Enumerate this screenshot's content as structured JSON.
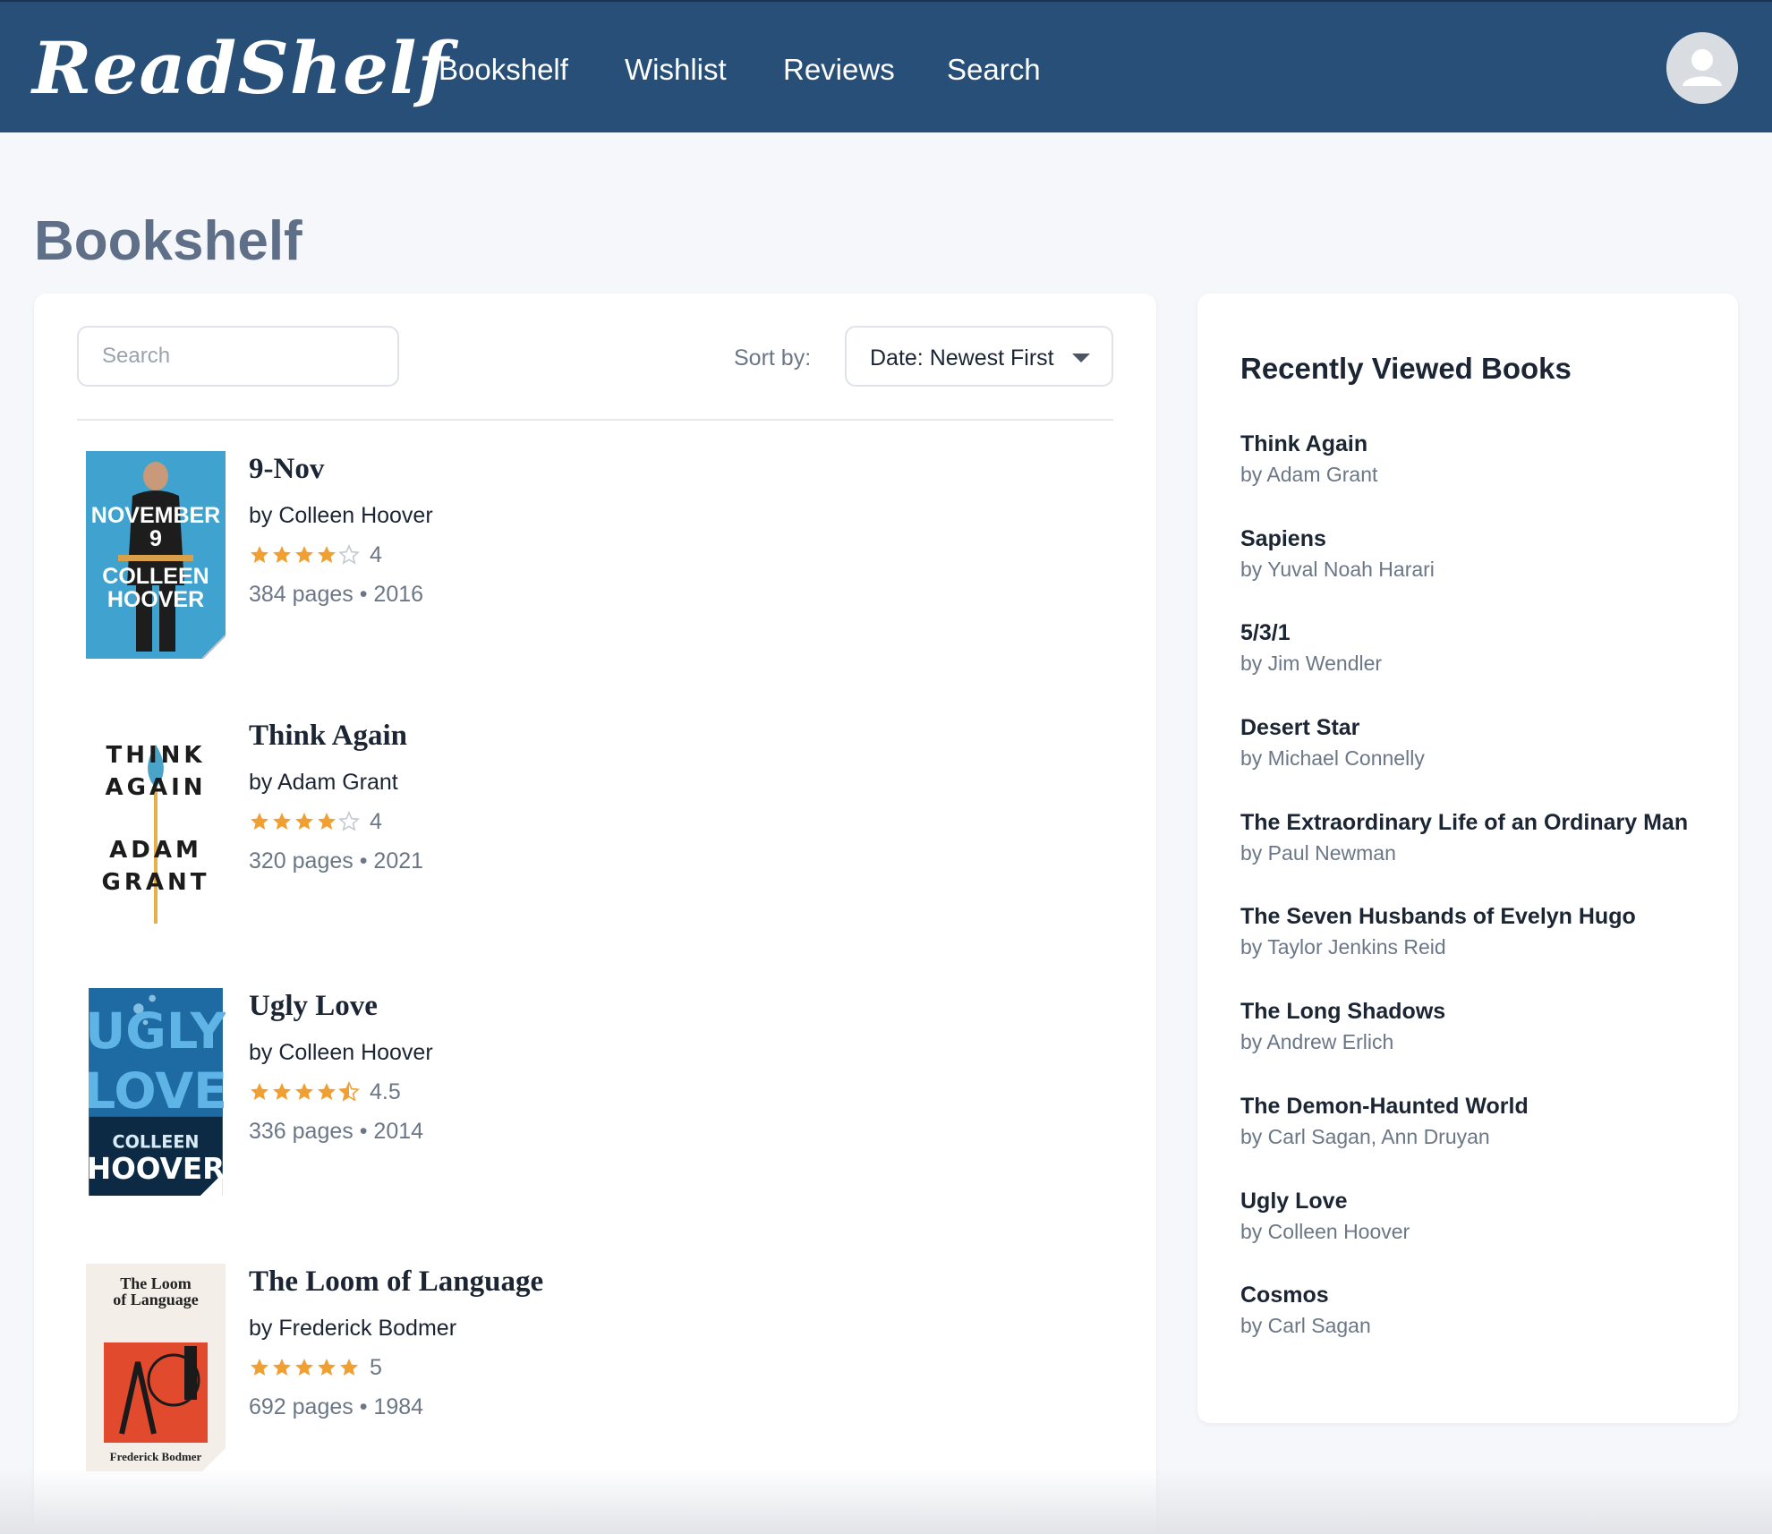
{
  "app": {
    "logo": "ReadShelf"
  },
  "nav": {
    "items": [
      "Bookshelf",
      "Wishlist",
      "Reviews",
      "Search"
    ]
  },
  "page": {
    "title": "Bookshelf"
  },
  "toolbar": {
    "search_placeholder": "Search",
    "sort_label": "Sort by:",
    "sort_value": "Date: Newest First"
  },
  "books": [
    {
      "title": "9-Nov",
      "author": "by Colleen Hoover",
      "rating": 4,
      "rating_text": "4",
      "meta": "384 pages • 2016",
      "cover_text": [
        "NOVEMBER",
        "9",
        "COLLEEN",
        "HOOVER"
      ]
    },
    {
      "title": "Think Again",
      "author": "by Adam Grant",
      "rating": 4,
      "rating_text": "4",
      "meta": "320 pages • 2021",
      "cover_text": [
        "THINK",
        "AGAIN",
        "ADAM",
        "GRANT"
      ]
    },
    {
      "title": "Ugly Love",
      "author": "by Colleen Hoover",
      "rating": 4.5,
      "rating_text": "4.5",
      "meta": "336 pages • 2014",
      "cover_text": [
        "UGLY",
        "LOVE",
        "COLLEEN",
        "HOOVER"
      ]
    },
    {
      "title": "The Loom of Language",
      "author": "by Frederick Bodmer",
      "rating": 5,
      "rating_text": "5",
      "meta": "692 pages • 1984",
      "cover_text": [
        "The Loom",
        "of Language",
        "Frederick Bodmer"
      ]
    }
  ],
  "recent": {
    "title": "Recently Viewed Books",
    "items": [
      {
        "title": "Think Again",
        "author": "by Adam Grant"
      },
      {
        "title": "Sapiens",
        "author": "by Yuval Noah Harari"
      },
      {
        "title": "5/3/1",
        "author": "by Jim Wendler"
      },
      {
        "title": "Desert Star",
        "author": "by Michael Connelly"
      },
      {
        "title": "The Extraordinary Life of an Ordinary Man",
        "author": "by Paul Newman"
      },
      {
        "title": "The Seven Husbands of Evelyn Hugo",
        "author": "by Taylor Jenkins Reid"
      },
      {
        "title": "The Long Shadows",
        "author": "by Andrew Erlich"
      },
      {
        "title": "The Demon-Haunted World",
        "author": "by Carl Sagan, Ann Druyan"
      },
      {
        "title": "Ugly Love",
        "author": "by Colleen Hoover"
      },
      {
        "title": "Cosmos",
        "author": "by Carl Sagan"
      }
    ]
  },
  "icons": {
    "avatar": "user-avatar-icon",
    "sort_caret": "caret-down-icon",
    "star": "star-icon"
  },
  "colors": {
    "header": "#284f77",
    "star": "#f0a033",
    "star_empty": "#c4c9d0",
    "muted_text": "#6b7787"
  }
}
